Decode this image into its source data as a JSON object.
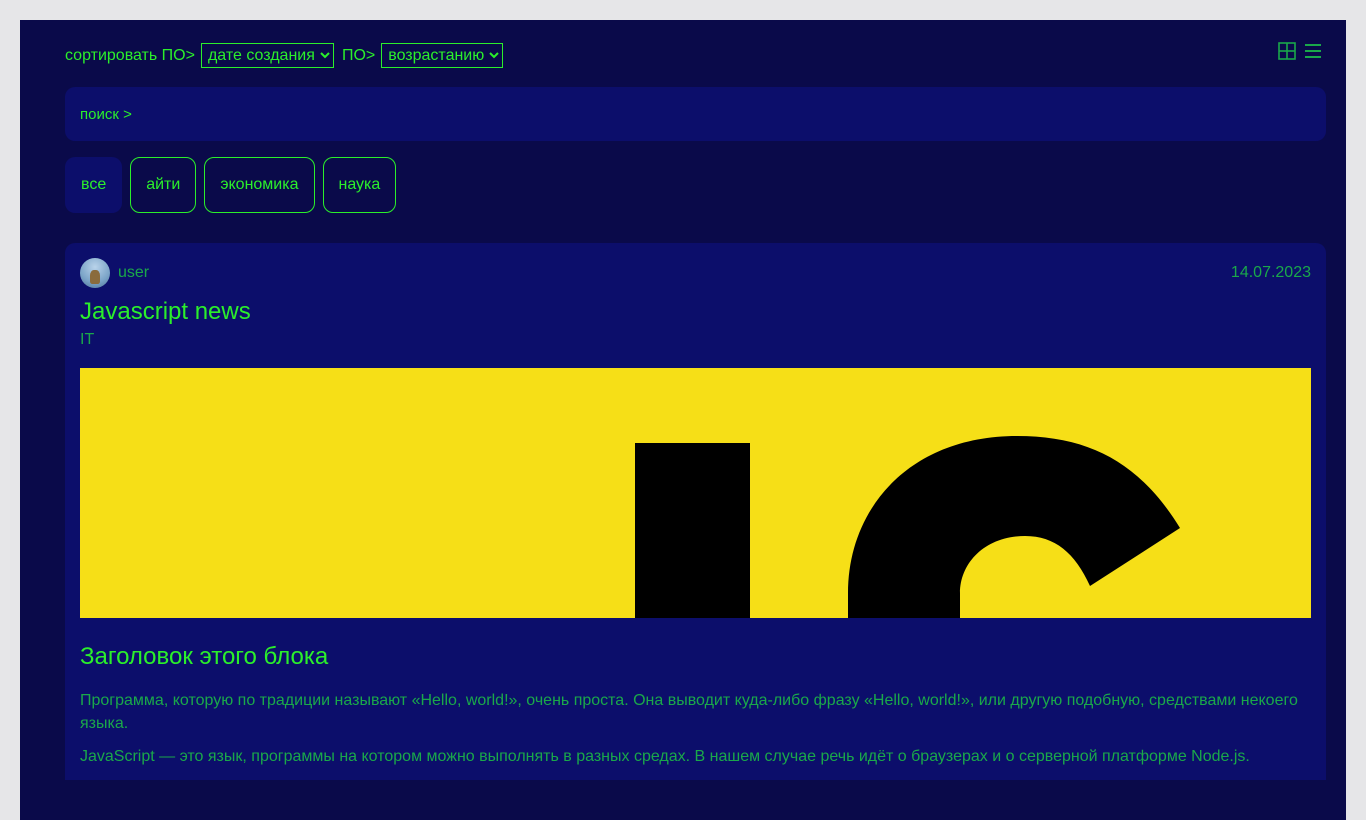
{
  "toolbar": {
    "sort_label": "сортировать ПО>",
    "sort_field": {
      "selected": "дате создания",
      "options": [
        "дате создания"
      ]
    },
    "order_label": "ПО>",
    "sort_order": {
      "selected": "возрастанию",
      "options": [
        "возрастанию"
      ]
    },
    "view_icons": [
      "grid-view-icon",
      "list-view-icon"
    ]
  },
  "search": {
    "label": "поиск >"
  },
  "tags": [
    {
      "label": "все",
      "active": true
    },
    {
      "label": "айти",
      "active": false
    },
    {
      "label": "экономика",
      "active": false
    },
    {
      "label": "наука",
      "active": false
    }
  ],
  "post": {
    "author": "user",
    "date": "14.07.2023",
    "title": "Javascript news",
    "category": "IT",
    "cover_text": "JS",
    "block_title": "Заголовок этого блока",
    "paragraphs": [
      "Программа, которую по традиции называют «Hello, world!», очень проста. Она выводит куда-либо фразу «Hello, world!», или другую подобную, средствами некоего языка.",
      "JavaScript — это язык, программы на котором можно выполнять в разных средах. В нашем случае речь идёт о браузерах и о серверной платформе Node.js."
    ]
  },
  "colors": {
    "background": "#0a0a4a",
    "panel": "#0c0e6b",
    "accent": "#2bef2b",
    "muted_text": "#1aa84a",
    "cover": "#f6df17"
  }
}
